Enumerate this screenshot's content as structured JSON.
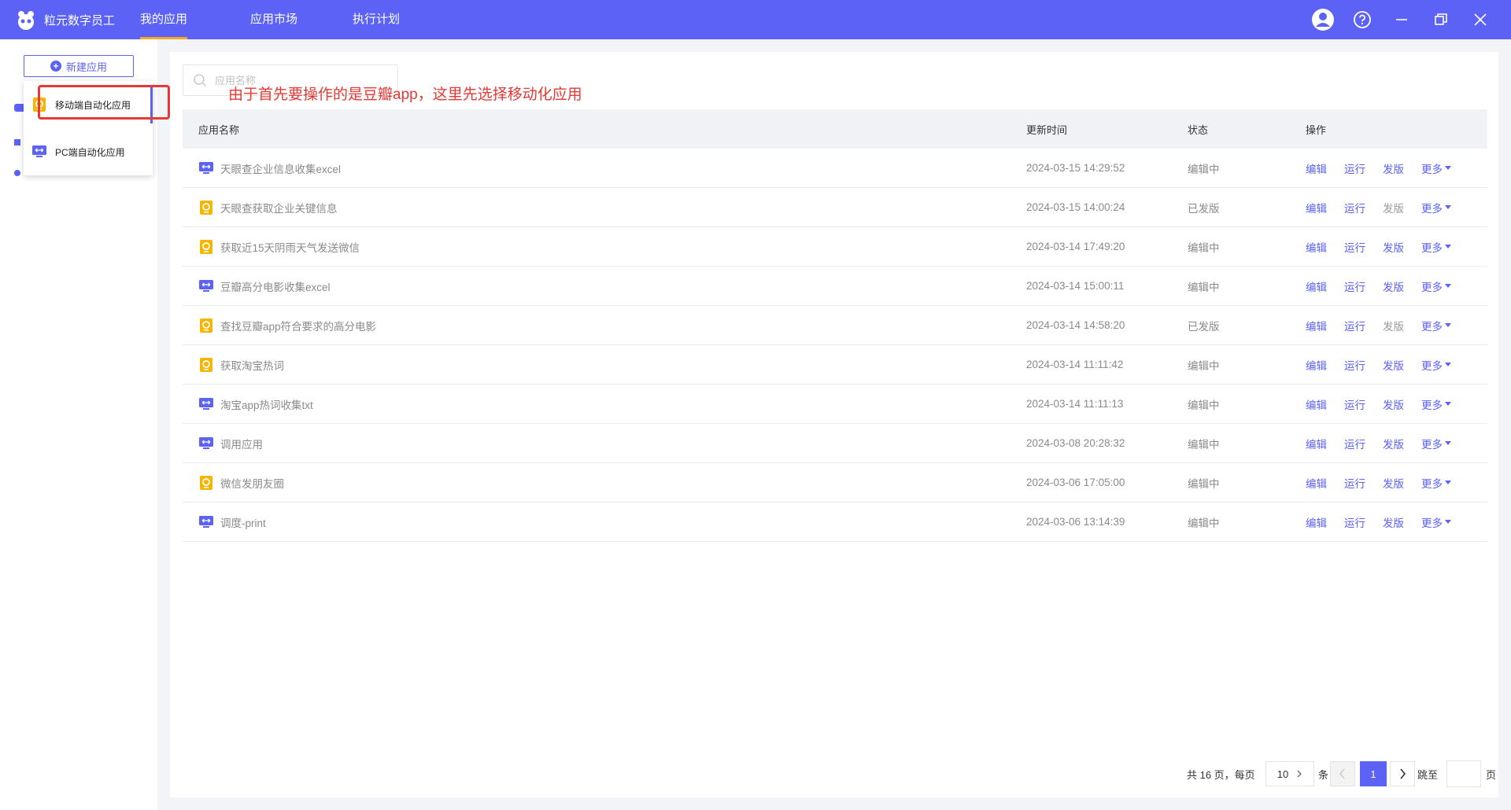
{
  "colors": {
    "primary": "#5b62f5",
    "accent_underline": "#f5a623",
    "annotation": "#e53935",
    "mobile_icon": "#f7b500"
  },
  "header": {
    "app_name": "粒元数字员工",
    "tabs": [
      {
        "label": "我的应用",
        "active": true
      },
      {
        "label": "应用市场",
        "active": false
      },
      {
        "label": "执行计划",
        "active": false
      }
    ],
    "icons": [
      "user-avatar-icon",
      "help-icon",
      "minimize-icon",
      "restore-icon",
      "close-icon"
    ]
  },
  "sidebar": {
    "new_app_label": "新建应用",
    "dropdown": [
      {
        "label": "移动端自动化应用",
        "icon": "mobile-app-icon"
      },
      {
        "label": "PC端自动化应用",
        "icon": "pc-app-icon"
      }
    ]
  },
  "annotation": "由于首先要操作的是豆瓣app，这里先选择移动化应用",
  "search": {
    "placeholder": "应用名称"
  },
  "table": {
    "columns": [
      "应用名称",
      "更新时间",
      "状态",
      "操作"
    ],
    "ops": {
      "edit": "编辑",
      "run": "运行",
      "publish": "发版",
      "more": "更多"
    },
    "rows": [
      {
        "type": "pc",
        "name": "天眼查企业信息收集excel",
        "time": "2024-03-15 14:29:52",
        "status": "编辑中",
        "publish_enabled": true
      },
      {
        "type": "mobile",
        "name": "天眼查获取企业关键信息",
        "time": "2024-03-15 14:00:24",
        "status": "已发版",
        "publish_enabled": false
      },
      {
        "type": "mobile",
        "name": "获取近15天阴雨天气发送微信",
        "time": "2024-03-14 17:49:20",
        "status": "编辑中",
        "publish_enabled": true
      },
      {
        "type": "pc",
        "name": "豆瓣高分电影收集excel",
        "time": "2024-03-14 15:00:11",
        "status": "编辑中",
        "publish_enabled": true
      },
      {
        "type": "mobile",
        "name": "查找豆瓣app符合要求的高分电影",
        "time": "2024-03-14 14:58:20",
        "status": "已发版",
        "publish_enabled": false
      },
      {
        "type": "mobile",
        "name": "获取淘宝热词",
        "time": "2024-03-14 11:11:42",
        "status": "编辑中",
        "publish_enabled": true
      },
      {
        "type": "pc",
        "name": "淘宝app热词收集txt",
        "time": "2024-03-14 11:11:13",
        "status": "编辑中",
        "publish_enabled": true
      },
      {
        "type": "pc",
        "name": "调用应用",
        "time": "2024-03-08 20:28:32",
        "status": "编辑中",
        "publish_enabled": true
      },
      {
        "type": "mobile",
        "name": "微信发朋友圈",
        "time": "2024-03-06 17:05:00",
        "status": "编辑中",
        "publish_enabled": true
      },
      {
        "type": "pc",
        "name": "调度-print",
        "time": "2024-03-06 13:14:39",
        "status": "编辑中",
        "publish_enabled": true
      }
    ]
  },
  "pagination": {
    "total_text": "共 16 页，每页",
    "page_size": "10",
    "unit": "条",
    "current_page": "1",
    "jump_label": "跳至",
    "page_suffix": "页"
  }
}
